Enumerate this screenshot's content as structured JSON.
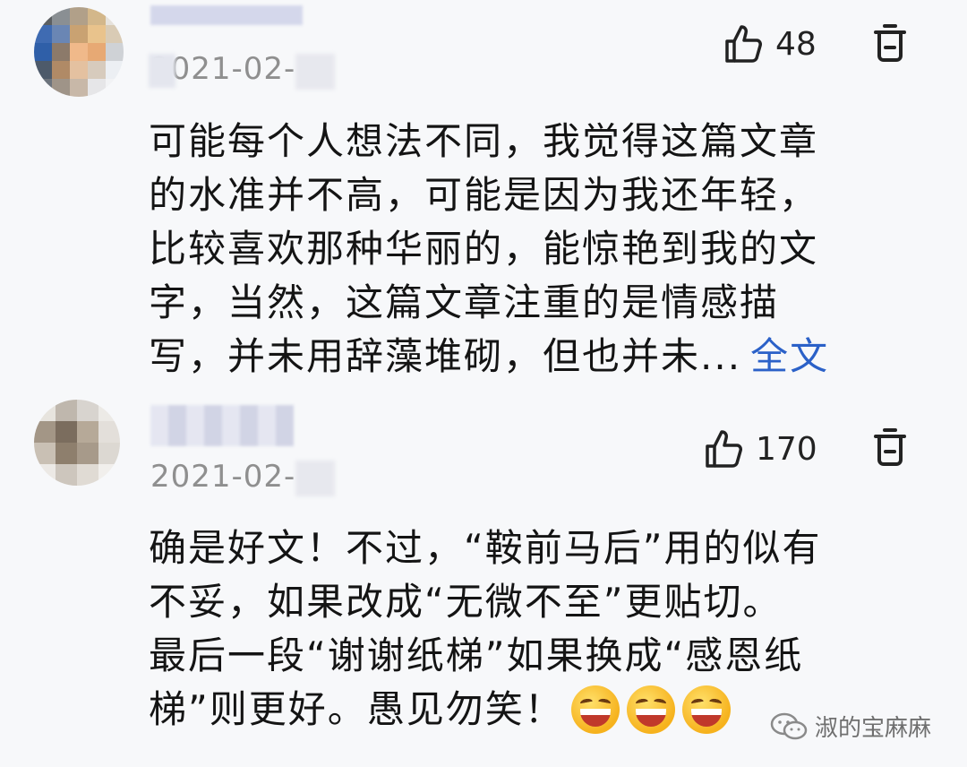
{
  "comments": [
    {
      "date": "2021-02-",
      "likes": "48",
      "lines": [
        "可能每个人想法不同，我觉得这篇文章",
        "的水准并不高，可能是因为我还年轻，",
        "比较喜欢那种华丽的，能惊艳到我的文",
        "字，当然，这篇文章注重的是情感描",
        "写，并未用辞藻堆砌，但也并未"
      ],
      "ellipsis": "...",
      "more_label": "全文"
    },
    {
      "date": "2021-02-",
      "likes": "170",
      "lines": [
        "确是好文！不过，“鞍前马后”用的似有",
        "不妥，如果改成“无微不至”更贴切。",
        "最后一段“谢谢纸梯”如果换成“感恩纸",
        "梯”则更好。愚见勿笑！"
      ],
      "emoji": [
        "grinning-squinting-face",
        "grinning-squinting-face",
        "grinning-squinting-face"
      ]
    }
  ],
  "watermark": {
    "text": "淑的宝麻麻",
    "icon": "wechat-icon"
  },
  "colors": {
    "link": "#2b61c8",
    "muted": "#8f8f8f",
    "background": "#f7f8fa"
  }
}
